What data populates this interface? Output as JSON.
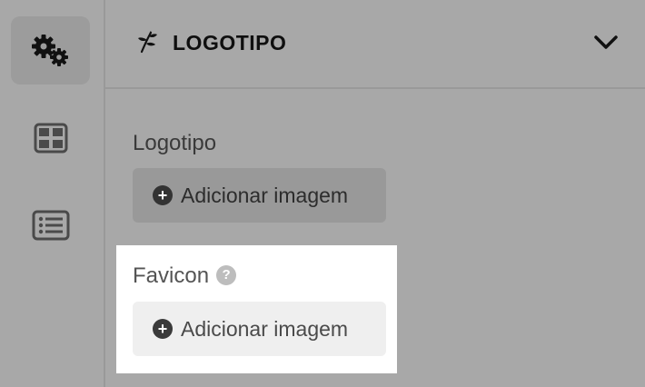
{
  "sidebar": {
    "items": [
      {
        "icon": "settings-gears-icon",
        "active": true
      },
      {
        "icon": "grid-icon",
        "active": false
      },
      {
        "icon": "list-icon",
        "active": false
      }
    ]
  },
  "section": {
    "title": "LOGOTIPO",
    "icon": "leaf-icon",
    "toggle_icon": "chevron-down-icon"
  },
  "fields": {
    "logo": {
      "label": "Logotipo",
      "button_label": "Adicionar imagem"
    },
    "favicon": {
      "label": "Favicon",
      "help_glyph": "?",
      "button_label": "Adicionar imagem"
    }
  },
  "colors": {
    "background": "#a8a8a8",
    "highlight": "#ffffff"
  }
}
